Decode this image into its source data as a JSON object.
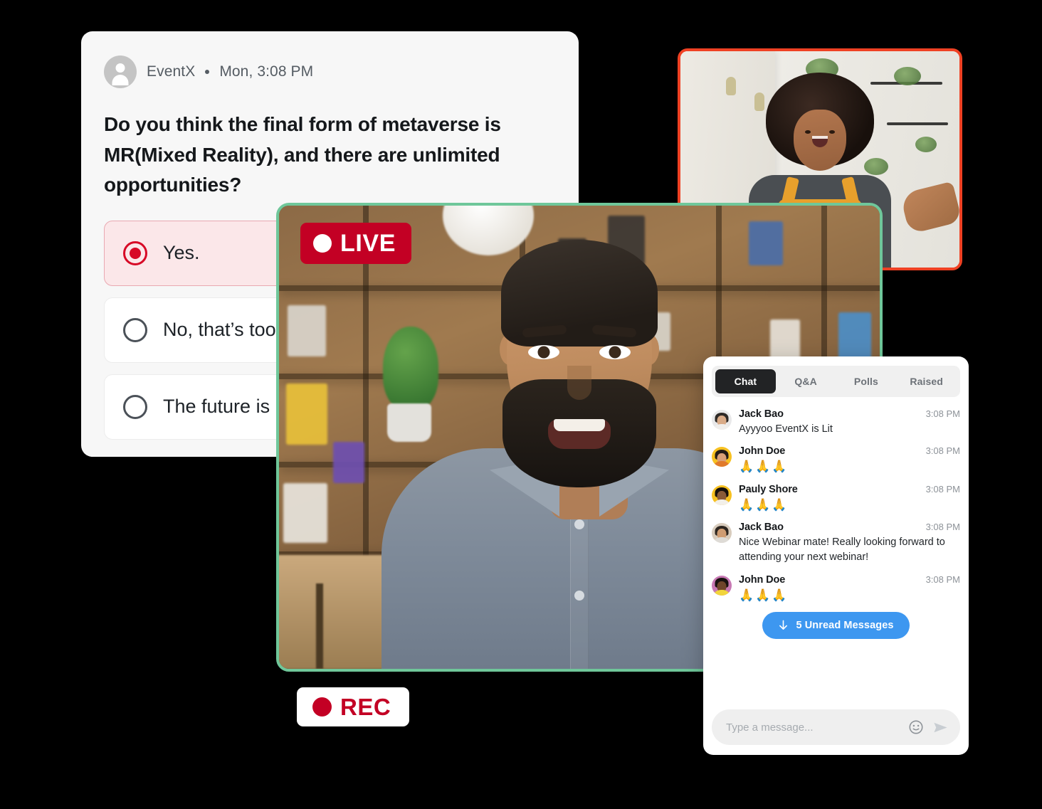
{
  "poll": {
    "author": "EventX",
    "timestamp": "Mon, 3:08 PM",
    "question": "Do you think the final form of metaverse is MR(Mixed Reality), and there are unlimited opportunities?",
    "options": [
      {
        "label": "Yes.",
        "selected": true
      },
      {
        "label": "No, that’s too",
        "selected": false
      },
      {
        "label": "The future is",
        "selected": false
      }
    ]
  },
  "badges": {
    "live": "LIVE",
    "rec": "REC"
  },
  "chat": {
    "tabs": [
      {
        "label": "Chat",
        "active": true
      },
      {
        "label": "Q&A",
        "active": false
      },
      {
        "label": "Polls",
        "active": false
      },
      {
        "label": "Raised",
        "active": false
      }
    ],
    "messages": [
      {
        "name": "Jack Bao",
        "time": "3:08 PM",
        "text": "Ayyyoo EventX is Lit",
        "emoji": false,
        "avatar": "#e9e9ea"
      },
      {
        "name": "John Doe",
        "time": "3:08 PM",
        "text": "🙏🙏🙏",
        "emoji": true,
        "avatar": "#f7c121"
      },
      {
        "name": "Pauly Shore",
        "time": "3:08 PM",
        "text": "🙏🙏🙏",
        "emoji": true,
        "avatar": "#f7c121"
      },
      {
        "name": "Jack Bao",
        "time": "3:08 PM",
        "text": "Nice Webinar mate! Really looking forward to attending your next webinar!",
        "emoji": false,
        "avatar": "#d8ccbd"
      },
      {
        "name": "John Doe",
        "time": "3:08 PM",
        "text": "🙏🙏🙏",
        "emoji": true,
        "avatar": "#c879b4"
      }
    ],
    "unread_label": "5 Unread Messages",
    "input_placeholder": "Type a message..."
  },
  "colors": {
    "accent_red": "#c30024",
    "poll_selected_border": "#e9a8b1",
    "poll_selected_bg": "#fbe7e9",
    "unread_blue": "#3d97f0",
    "main_video_border": "#6fc79a",
    "self_video_border": "#ef4123",
    "tab_active_bg": "#222325"
  }
}
